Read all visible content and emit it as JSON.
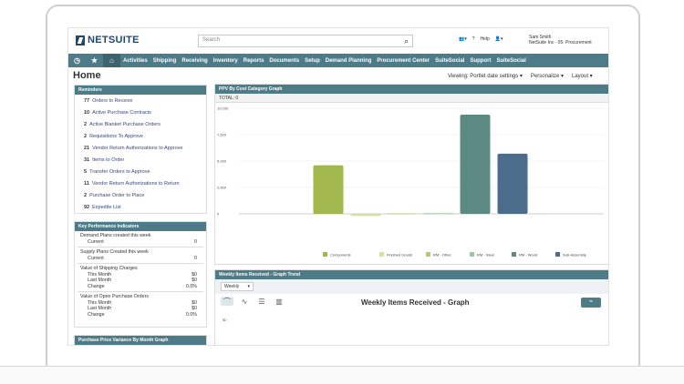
{
  "brand": "NETSUITE",
  "search": {
    "placeholder": "Search"
  },
  "topbar": {
    "help": "Help",
    "user_name": "Sam Smith",
    "user_role": "NetSuite Inc - 05: Procurement"
  },
  "nav": {
    "items": [
      "Activities",
      "Shipping",
      "Receiving",
      "Inventory",
      "Reports",
      "Documents",
      "Setup",
      "Demand Planning",
      "Procurement Center",
      "SuiteSocial",
      "Support",
      "SuiteSocial"
    ]
  },
  "page": {
    "title": "Home",
    "viewing": "Viewing: Portlet date settings ▾",
    "personalize": "Personalize ▾",
    "layout": "Layout ▾"
  },
  "reminders": {
    "title": "Reminders",
    "items": [
      {
        "num": "77",
        "label": "Orders to Receive"
      },
      {
        "num": "10",
        "label": "Active Purchase Contracts"
      },
      {
        "num": "2",
        "label": "Active Blanket Purchase Orders"
      },
      {
        "num": "2",
        "label": "Requisitions To Approve"
      },
      {
        "num": "21",
        "label": "Vendor Return Authorizations to Approve"
      },
      {
        "num": "31",
        "label": "Items to Order"
      },
      {
        "num": "5",
        "label": "Transfer Orders to Approve"
      },
      {
        "num": "11",
        "label": "Vendor Return Authorizations to Return"
      },
      {
        "num": "2",
        "label": "Purchase Order to Place"
      },
      {
        "num": "92",
        "label": "Expedite List"
      }
    ]
  },
  "kpi": {
    "title": "Key Performance Indicators",
    "groups": [
      {
        "label": "Demand Plans created this week",
        "rows": [
          {
            "k": "Current",
            "v": "0"
          }
        ]
      },
      {
        "label": "Supply Plans Created this week",
        "rows": [
          {
            "k": "Current",
            "v": "0"
          }
        ]
      },
      {
        "label": "Value of Shipping Charges",
        "rows": [
          {
            "k": "This Month",
            "v": "$0"
          },
          {
            "k": "Last Month",
            "v": "$0"
          },
          {
            "k": "Change",
            "v": "0.0%"
          }
        ]
      },
      {
        "label": "Value of Open Purchase Orders",
        "rows": [
          {
            "k": "This Month",
            "v": "$0"
          },
          {
            "k": "Last Month",
            "v": "$0"
          },
          {
            "k": "Change",
            "v": "0.0%"
          }
        ]
      }
    ]
  },
  "ppv_month": {
    "title": "Purchase Price Variance By Month Graph"
  },
  "ppv_graph": {
    "title": "PPV By Cost Category Graph",
    "total": "TOTAL: 0"
  },
  "weekly": {
    "title": "Weekly Items Received - Graph Trend",
    "period": "Weekly",
    "graph_title": "Weekly Items Received - Graph",
    "ylabel": "$0"
  },
  "chart_data": {
    "type": "bar",
    "title": "",
    "categories": [
      "Components",
      "Finished Goods",
      "RM - Other",
      "RM - Steel",
      "RM - Wood",
      "Sub-Assembly"
    ],
    "values": [
      4600,
      -200,
      40,
      60,
      9400,
      5700
    ],
    "colors": [
      "#a2b84e",
      "#d7e19a",
      "#b9c77b",
      "#9dc89a",
      "#5c8a83",
      "#4b6c8a"
    ],
    "yticks": [
      "10,000",
      "7,500",
      "5,000",
      "2,500",
      "0"
    ],
    "ylim": [
      -500,
      10000
    ]
  }
}
